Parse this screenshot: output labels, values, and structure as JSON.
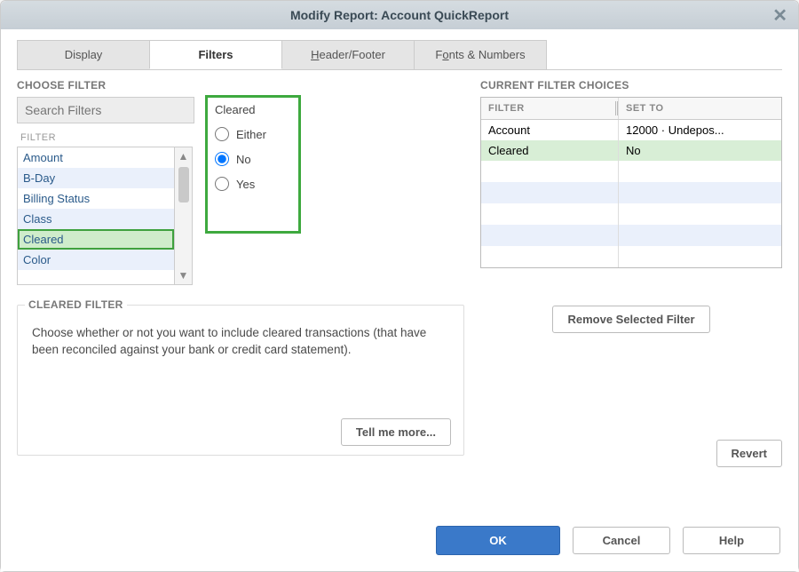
{
  "title": "Modify Report: Account QuickReport",
  "tabs": {
    "display": "Display",
    "filters": "Filters",
    "header_footer": "Header/Footer",
    "fonts_numbers": "Fonts & Numbers"
  },
  "choose_filter_label": "CHOOSE FILTER",
  "search_placeholder": "Search Filters",
  "filter_col_label": "FILTER",
  "filter_items": {
    "0": "Amount",
    "1": "B-Day",
    "2": "Billing Status",
    "3": "Class",
    "4": "Cleared",
    "5": "Color"
  },
  "cleared_panel": {
    "heading": "Cleared",
    "opt_either": "Either",
    "opt_no": "No",
    "opt_yes": "Yes"
  },
  "cleared_filter_label": "CLEARED FILTER",
  "cleared_filter_text": "Choose whether or not you want to include cleared transactions (that have been reconciled against your bank or credit card statement).",
  "tell_more": "Tell me more...",
  "current_choices_label": "CURRENT FILTER CHOICES",
  "choices_headers": {
    "filter": "FILTER",
    "set_to": "SET TO"
  },
  "choices_rows": {
    "0": {
      "filter": "Account",
      "set_to": "12000 · Undepos..."
    },
    "1": {
      "filter": "Cleared",
      "set_to": "No"
    }
  },
  "remove_selected": "Remove Selected Filter",
  "revert": "Revert",
  "ok": "OK",
  "cancel": "Cancel",
  "help": "Help"
}
